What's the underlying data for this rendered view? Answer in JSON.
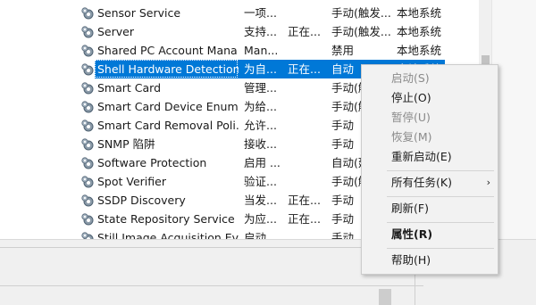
{
  "services": [
    {
      "name": "Sensor Service",
      "desc": "一项...",
      "status": "",
      "startup": "手动(触发...",
      "logon": "本地系统"
    },
    {
      "name": "Server",
      "desc": "支持...",
      "status": "正在...",
      "startup": "手动(触发...",
      "logon": "本地系统"
    },
    {
      "name": "Shared PC Account Mana...",
      "desc": "Man...",
      "status": "",
      "startup": "禁用",
      "logon": "本地系统"
    },
    {
      "name": "Shell Hardware Detection",
      "desc": "为自...",
      "status": "正在...",
      "startup": "自动",
      "logon": "本地系统"
    },
    {
      "name": "Smart Card",
      "desc": "管理...",
      "status": "",
      "startup": "手动(触",
      "logon": ""
    },
    {
      "name": "Smart Card Device Enum...",
      "desc": "为给...",
      "status": "",
      "startup": "手动(触",
      "logon": ""
    },
    {
      "name": "Smart Card Removal Poli...",
      "desc": "允许...",
      "status": "",
      "startup": "手动",
      "logon": ""
    },
    {
      "name": "SNMP 陷阱",
      "desc": "接收...",
      "status": "",
      "startup": "手动",
      "logon": ""
    },
    {
      "name": "Software Protection",
      "desc": "启用 ...",
      "status": "",
      "startup": "自动(延",
      "logon": ""
    },
    {
      "name": "Spot Verifier",
      "desc": "验证...",
      "status": "",
      "startup": "手动(触",
      "logon": ""
    },
    {
      "name": "SSDP Discovery",
      "desc": "当发...",
      "status": "正在...",
      "startup": "手动",
      "logon": ""
    },
    {
      "name": "State Repository Service",
      "desc": "为应...",
      "status": "正在...",
      "startup": "手动",
      "logon": ""
    },
    {
      "name": "Still Image Acquisition Ev...",
      "desc": "启动...",
      "status": "",
      "startup": "手动",
      "logon": ""
    }
  ],
  "selected_index": 3,
  "context_menu": {
    "start": "启动(S)",
    "stop": "停止(O)",
    "pause": "暂停(U)",
    "resume": "恢复(M)",
    "restart": "重新启动(E)",
    "all_tasks": "所有任务(K)",
    "refresh": "刷新(F)",
    "properties": "属性(R)",
    "help": "帮助(H)"
  },
  "colors": {
    "selection": "#0078d7",
    "menu_bg": "#f2f2f2"
  }
}
